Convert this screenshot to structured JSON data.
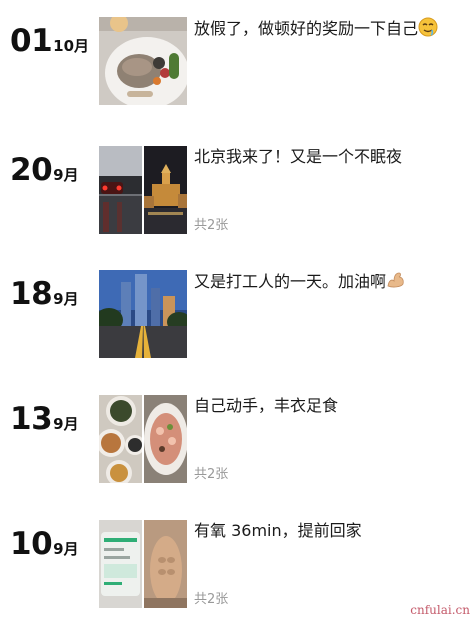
{
  "posts": [
    {
      "day": "01",
      "month": "10月",
      "caption": "放假了，做顿好的奖励一下自己",
      "emoji": "drooling-face-icon",
      "photos": [
        "food-plate-photo"
      ]
    },
    {
      "day": "20",
      "month": "9月",
      "caption": "北京我来了！又是一个不眠夜",
      "count": "共2张",
      "photos": [
        "rainy-street-photo",
        "night-station-photo"
      ]
    },
    {
      "day": "18",
      "month": "9月",
      "caption": "又是打工人的一天。加油啊",
      "emoji": "flexed-biceps-icon",
      "photos": [
        "city-skyline-photo"
      ]
    },
    {
      "day": "13",
      "month": "9月",
      "caption": "自己动手，丰衣足食",
      "count": "共2张",
      "photos": [
        "dishes-photo",
        "seafood-plate-photo"
      ]
    },
    {
      "day": "10",
      "month": "9月",
      "caption": "有氧 36min，提前回家",
      "count": "共2张",
      "photos": [
        "phone-app-photo",
        "body-mirror-photo"
      ]
    }
  ],
  "watermark": "cnfulai.cn"
}
